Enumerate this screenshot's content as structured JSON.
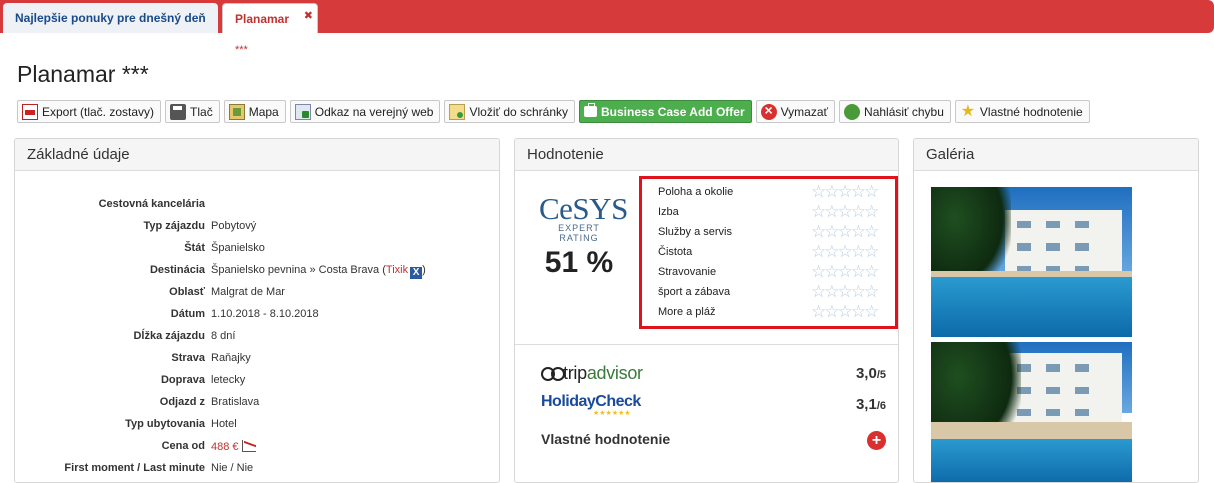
{
  "tabs": [
    {
      "label": "Najlepšie ponuky pre dnešný deň"
    },
    {
      "label": "Planamar",
      "stars": "***"
    }
  ],
  "page_title": "Planamar ***",
  "toolbar": [
    {
      "label": "Export (tlač. zostavy)",
      "icon": "pdf-icon"
    },
    {
      "label": "Tlač",
      "icon": "print-icon"
    },
    {
      "label": "Mapa",
      "icon": "map-icon"
    },
    {
      "label": "Odkaz na verejný web",
      "icon": "link-icon"
    },
    {
      "label": "Vložiť do schránky",
      "icon": "clipboard-icon"
    },
    {
      "label": "Business Case Add Offer",
      "icon": "briefcase-icon"
    },
    {
      "label": "Vymazať",
      "icon": "delete-icon"
    },
    {
      "label": "Nahlásiť chybu",
      "icon": "bug-icon"
    },
    {
      "label": "Vlastné hodnotenie",
      "icon": "star-icon"
    }
  ],
  "basic": {
    "title": "Základné údaje",
    "rows": [
      {
        "k": "Cestovná kancelária",
        "v": ""
      },
      {
        "k": "Typ zájazdu",
        "v": "Pobytový"
      },
      {
        "k": "Štát",
        "v": "Španielsko"
      },
      {
        "k": "Destinácia",
        "v": "Španielsko pevnina » Costa Brava",
        "link": "Tixik"
      },
      {
        "k": "Oblasť",
        "v": "Malgrat de Mar"
      },
      {
        "k": "Dátum",
        "v": "1.10.2018 - 8.10.2018"
      },
      {
        "k": "Dĺžka zájazdu",
        "v": "8 dní"
      },
      {
        "k": "Strava",
        "v": "Raňajky"
      },
      {
        "k": "Doprava",
        "v": "letecky"
      },
      {
        "k": "Odjazd z",
        "v": "Bratislava"
      },
      {
        "k": "Typ ubytovania",
        "v": "Hotel"
      },
      {
        "k": "Cena od",
        "v": "488 €"
      },
      {
        "k": "First moment / Last minute",
        "v": "Nie / Nie"
      }
    ]
  },
  "rating": {
    "title": "Hodnotenie",
    "cesys_logo": "CeSYS",
    "cesys_sub": "EXPERT RATING",
    "cesys_pct": "51 %",
    "categories": [
      "Poloha a okolie",
      "Izba",
      "Služby a servis",
      "Čistota",
      "Stravovanie",
      "šport a zábava",
      "More a pláž"
    ],
    "star_count": 5,
    "tripadvisor": {
      "logo_main": "trip",
      "logo_accent": "advisor",
      "score": "3,0",
      "max": "/5"
    },
    "holidaycheck": {
      "logo": "HolidayCheck",
      "score": "3,1",
      "max": "/6"
    },
    "own_label": "Vlastné hodnotenie"
  },
  "gallery": {
    "title": "Galéria"
  },
  "colors": {
    "brand_red": "#d63a3a",
    "highlight": "#e0121b",
    "accent_green": "#4cae4c",
    "price_red": "#c0322f"
  }
}
